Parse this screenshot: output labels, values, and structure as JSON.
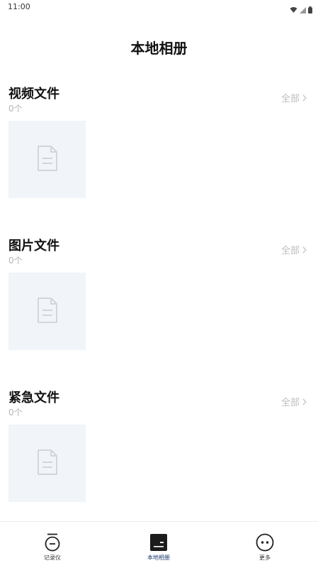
{
  "status_bar": {
    "time": "11:00",
    "icons": [
      "wifi-icon",
      "signal-icon",
      "battery-icon"
    ]
  },
  "page": {
    "title": "本地相册"
  },
  "sections": [
    {
      "title": "视频文件",
      "count": "0个",
      "view_all": "全部",
      "placeholder_icon": "document-icon"
    },
    {
      "title": "图片文件",
      "count": "0个",
      "view_all": "全部",
      "placeholder_icon": "document-icon"
    },
    {
      "title": "紧急文件",
      "count": "0个",
      "view_all": "全部",
      "placeholder_icon": "document-icon"
    }
  ],
  "tab_bar": {
    "tabs": [
      {
        "label": "记录仪",
        "icon": "recorder-icon",
        "active": false
      },
      {
        "label": "本地相册",
        "icon": "album-icon",
        "active": true
      },
      {
        "label": "更多",
        "icon": "more-icon",
        "active": false
      }
    ]
  },
  "colors": {
    "active_tab": "#1f3b6e",
    "placeholder_bg": "#f1f4f8",
    "muted_text": "#b3b3b3"
  }
}
